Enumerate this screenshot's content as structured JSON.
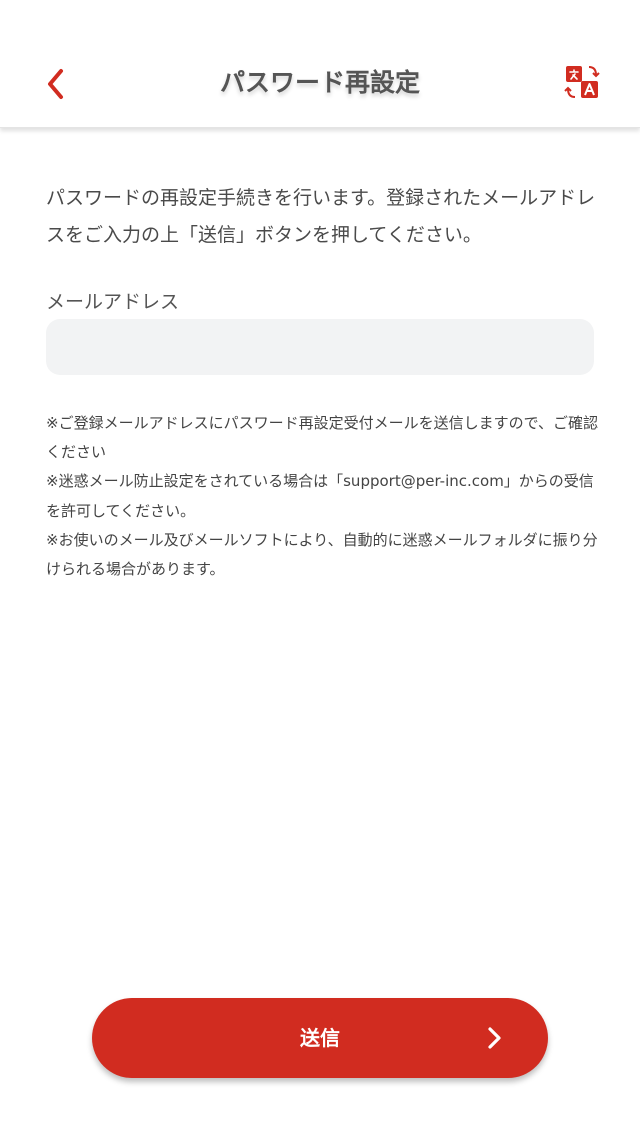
{
  "header": {
    "title": "パスワード再設定",
    "back_icon": "chevron-left-icon",
    "translate_icon": "translate-icon"
  },
  "intro": {
    "text": "パスワードの再設定手続きを行います。登録されたメールアドレスをご入力の上「送信」ボタンを押してください。"
  },
  "form": {
    "email_label": "メールアドレス",
    "email_value": "",
    "email_placeholder": ""
  },
  "notes": [
    "※ご登録メールアドレスにパスワード再設定受付メールを送信しますので、ご確認ください",
    "※迷惑メール防止設定をされている場合は「support@per-inc.com」からの受信を許可してください。",
    "※お使いのメール及びメールソフトにより、自動的に迷惑メールフォルダに振り分けられる場合があります。"
  ],
  "submit": {
    "label": "送信",
    "arrow_icon": "chevron-right-icon"
  },
  "colors": {
    "accent": "#d12c20",
    "input_bg": "#f2f3f4",
    "text": "#4a4a4a"
  }
}
